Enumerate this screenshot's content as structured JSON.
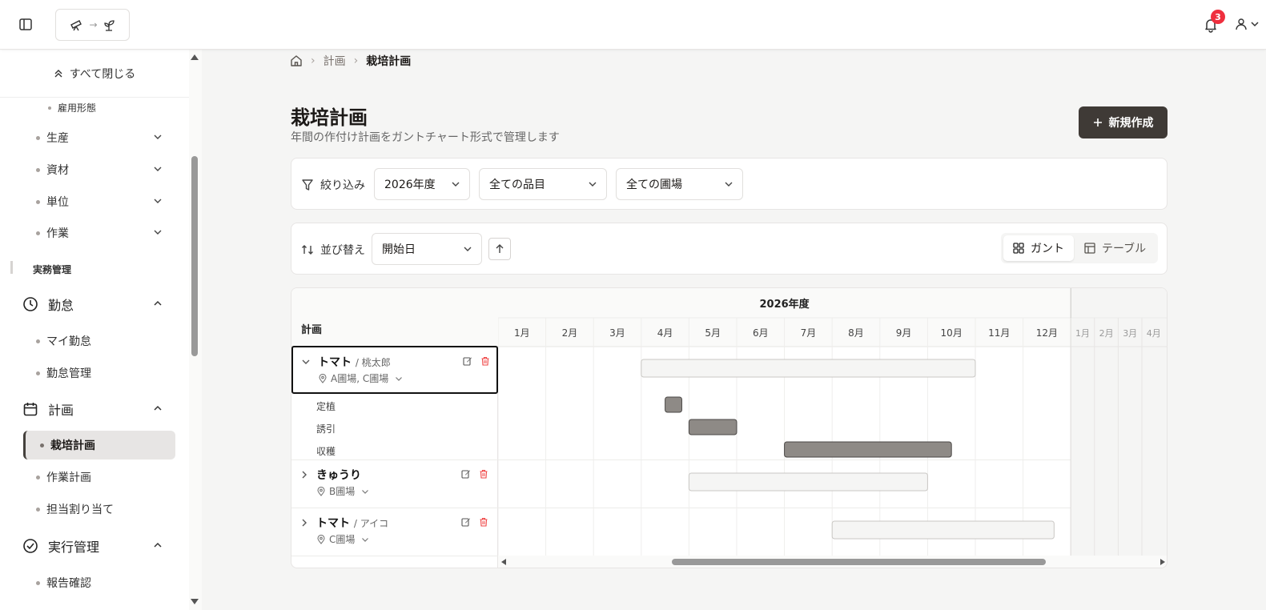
{
  "header": {
    "logo_arrow": "→",
    "notification_count": "3"
  },
  "sidebar": {
    "collapse_all_label": "すべて閉じる",
    "sub_item_top": "雇用形態",
    "masters": [
      {
        "label": "生産"
      },
      {
        "label": "資材"
      },
      {
        "label": "単位"
      },
      {
        "label": "作業"
      }
    ],
    "section_label": "実務管理",
    "groups": [
      {
        "label": "勤怠",
        "icon": "clock-icon",
        "items": [
          "マイ勤怠",
          "勤怠管理"
        ]
      },
      {
        "label": "計画",
        "icon": "calendar-icon",
        "items": [
          "栽培計画",
          "作業計画",
          "担当割り当て"
        ]
      },
      {
        "label": "実行管理",
        "icon": "check-circle-icon",
        "items": [
          "報告確認"
        ]
      }
    ],
    "active_item": "栽培計画"
  },
  "breadcrumb": {
    "items": [
      "計画",
      "栽培計画"
    ]
  },
  "page": {
    "title": "栽培計画",
    "subtitle": "年間の作付け計画をガントチャート形式で管理します",
    "new_button": "新規作成"
  },
  "filters": {
    "label": "絞り込み",
    "year": "2026年度",
    "item": "全ての品目",
    "field": "全ての圃場"
  },
  "sort": {
    "label": "並び替え",
    "value": "開始日",
    "direction": "asc"
  },
  "view_toggle": {
    "gantt": "ガント",
    "table": "テーブル",
    "active": "gantt"
  },
  "gantt": {
    "left_header": "計画",
    "year_label": "2026年度",
    "months": [
      "1月",
      "2月",
      "3月",
      "4月",
      "5月",
      "6月",
      "7月",
      "8月",
      "9月",
      "10月",
      "11月",
      "12月"
    ],
    "next_year_months": [
      "1月",
      "2月",
      "3月",
      "4月"
    ],
    "plans": [
      {
        "name": "トマト",
        "variety": "/ 桃太郎",
        "fields": "A圃場, C圃場",
        "expanded": true,
        "start_month": 4.0,
        "end_month": 11.0,
        "tasks": [
          {
            "name": "定植",
            "start_month": 4.5,
            "end_month": 4.85
          },
          {
            "name": "誘引",
            "start_month": 5.0,
            "end_month": 6.0
          },
          {
            "name": "収穫",
            "start_month": 7.0,
            "end_month": 10.5
          }
        ]
      },
      {
        "name": "きゅうり",
        "variety": "",
        "fields": "B圃場",
        "expanded": false,
        "start_month": 5.0,
        "end_month": 10.0,
        "tasks": []
      },
      {
        "name": "トマト",
        "variety": "/ アイコ",
        "fields": "C圃場",
        "expanded": false,
        "start_month": 8.0,
        "end_month": 12.65,
        "tasks": []
      }
    ]
  },
  "colors": {
    "primary": "#3f3a36",
    "danger": "#ef4444",
    "badge": "#ef2f3e",
    "bar_plan": "#f5f5f4",
    "bar_task": "#8e8a86"
  }
}
